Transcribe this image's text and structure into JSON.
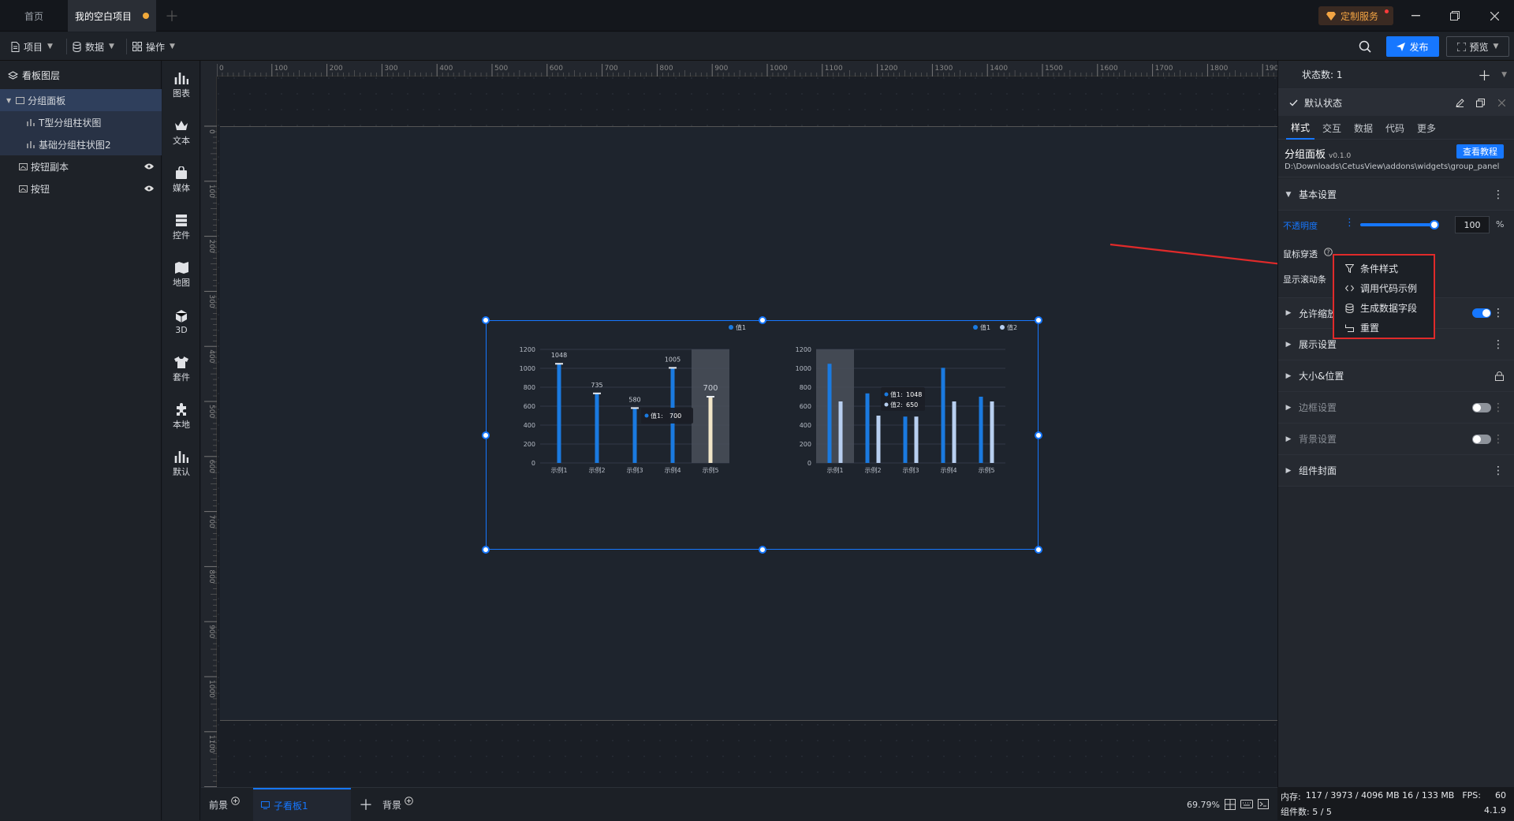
{
  "titlebar": {
    "tabs": [
      {
        "label": "首页"
      },
      {
        "label": "我的空白项目",
        "unsaved": true
      }
    ],
    "custom_service": "定制服务"
  },
  "toolbar": {
    "menus": [
      {
        "label": "项目",
        "icon": "file-icon"
      },
      {
        "label": "数据",
        "icon": "database-icon"
      },
      {
        "label": "操作",
        "icon": "grid-icon"
      }
    ],
    "publish_label": "发布",
    "preview_label": "预览"
  },
  "layers": {
    "title": "看板图层",
    "items": [
      {
        "label": "分组面板",
        "level": 0,
        "selected": true
      },
      {
        "label": "T型分组柱状图",
        "level": 1
      },
      {
        "label": "基础分组柱状图2",
        "level": 1
      },
      {
        "label": "按钮副本",
        "level": 0
      },
      {
        "label": "按钮",
        "level": 0
      }
    ]
  },
  "iconbar": {
    "items": [
      {
        "label": "图表",
        "icon": "bar-chart-icon"
      },
      {
        "label": "文本",
        "icon": "crown-icon"
      },
      {
        "label": "媒体",
        "icon": "bag-icon"
      },
      {
        "label": "控件",
        "icon": "stack-icon"
      },
      {
        "label": "地图",
        "icon": "map-icon"
      },
      {
        "label": "3D",
        "icon": "cube-icon"
      },
      {
        "label": "套件",
        "icon": "shirt-icon"
      },
      {
        "label": "本地",
        "icon": "puzzle-icon"
      },
      {
        "label": "默认",
        "icon": "bar-chart-icon"
      }
    ]
  },
  "ruler": {
    "top_labels": [
      "0",
      "100",
      "200",
      "300",
      "400",
      "500",
      "600",
      "700",
      "800",
      "900",
      "1000",
      "1100",
      "1200",
      "1300",
      "1400",
      "1500",
      "1600",
      "1700",
      "1800",
      "1900"
    ],
    "left_labels": [
      "0",
      "100",
      "200",
      "300",
      "400",
      "500",
      "600",
      "700",
      "800",
      "900",
      "1000",
      "1100",
      "1200"
    ]
  },
  "bottombar": {
    "front_label": "前景",
    "subboard_label": "子看板1",
    "back_label": "背景",
    "zoom": "69.79%"
  },
  "statusbar": {
    "memory": "内存:",
    "memory_values": "117 / 3973 / 4096 MB  16 / 133 MB",
    "fps_label": "FPS:",
    "fps": "60",
    "components": "组件数: 5 / 5",
    "version": "4.1.9"
  },
  "rpanel": {
    "state_count": "状态数: 1",
    "default_state": "默认状态",
    "tabs": [
      "样式",
      "交互",
      "数据",
      "代码",
      "更多"
    ],
    "component_name": "分组面板",
    "component_version": "v0.1.0",
    "tutorial_btn": "查看教程",
    "path": "D:\\Downloads\\CetusView\\addons\\widgets\\group_panel",
    "basic_settings": "基本设置",
    "opacity_label": "不透明度",
    "opacity_value": "100",
    "opacity_unit": "%",
    "mouse_through": "鼠标穿透",
    "show_scrollbar": "显示滚动条",
    "sections": [
      {
        "label": "允许缩放"
      },
      {
        "label": "展示设置"
      },
      {
        "label": "大小&位置"
      },
      {
        "label": "边框设置"
      },
      {
        "label": "背景设置"
      },
      {
        "label": "组件封面"
      }
    ]
  },
  "context_menu": {
    "items": [
      {
        "label": "条件样式",
        "icon": "filter-icon"
      },
      {
        "label": "调用代码示例",
        "icon": "code-icon"
      },
      {
        "label": "生成数据字段",
        "icon": "database-icon"
      },
      {
        "label": "重置",
        "icon": "reset-icon"
      }
    ]
  },
  "colors": {
    "accent": "#1677ff",
    "bar1": "#1a7ae0",
    "bar2": "#b8cff0",
    "highlight": "#f2e6c8",
    "annotation": "#e02a2a"
  },
  "chart_data": [
    {
      "type": "bar",
      "categories": [
        "示例1",
        "示例2",
        "示例3",
        "示例4",
        "示例5"
      ],
      "series": [
        {
          "name": "值1",
          "values": [
            1048,
            735,
            580,
            1005,
            700
          ]
        }
      ],
      "data_labels": [
        "1048",
        "735",
        "580",
        "1005",
        "700"
      ],
      "ylim": [
        0,
        1200
      ],
      "yticks": [
        "0",
        "200",
        "400",
        "600",
        "800",
        "1000",
        "1200"
      ],
      "tooltip": {
        "label": "值1:",
        "value": "700"
      },
      "legend": "top-right"
    },
    {
      "type": "bar",
      "categories": [
        "示例1",
        "示例2",
        "示例3",
        "示例4",
        "示例5"
      ],
      "series": [
        {
          "name": "值1",
          "values": [
            1048,
            735,
            490,
            1005,
            700
          ]
        },
        {
          "name": "值2",
          "values": [
            650,
            500,
            490,
            650,
            650
          ]
        }
      ],
      "legend_labels": [
        "值1",
        "值2"
      ],
      "ylim": [
        0,
        1200
      ],
      "yticks": [
        "0",
        "200",
        "400",
        "600",
        "800",
        "1000",
        "1200"
      ],
      "tooltip": {
        "label1": "值1:",
        "value1": "1048",
        "label2": "值2:",
        "value2": "650"
      },
      "legend": "top-right"
    }
  ]
}
